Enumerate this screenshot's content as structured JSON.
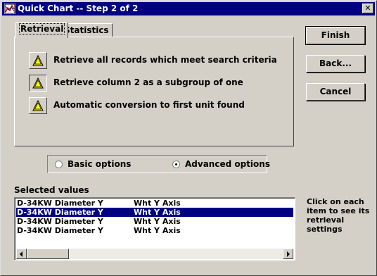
{
  "window": {
    "title": "Quick Chart -- Step 2 of 2",
    "close_label": "✕"
  },
  "tabs": [
    {
      "label": "Retrieval",
      "active": true
    },
    {
      "label": "Statistics",
      "active": false
    }
  ],
  "retrieval_options": [
    {
      "label": "Retrieve all records which meet search criteria",
      "icon": "warning-icon"
    },
    {
      "label": "Retrieve column 2 as a subgroup of one",
      "icon": "warning-icon"
    },
    {
      "label": "Automatic conversion to first unit found",
      "icon": "warning-icon"
    }
  ],
  "buttons": {
    "finish": "Finish",
    "back": "Back...",
    "cancel": "Cancel"
  },
  "options_mode": {
    "basic_label": "Basic options",
    "advanced_label": "Advanced options",
    "selected": "advanced"
  },
  "selected_values": {
    "label": "Selected values",
    "rows": [
      {
        "name": "D-34KW Diameter Y",
        "axis": "Wht Y Axis",
        "selected": false
      },
      {
        "name": "D-34KW Diameter Y",
        "axis": "Wht Y Axis",
        "selected": true
      },
      {
        "name": "D-34KW Diameter Y",
        "axis": "Wht Y Axis",
        "selected": false
      },
      {
        "name": "D-34KW Diameter Y",
        "axis": "Wht Y Axis",
        "selected": false
      }
    ]
  },
  "help_text": "Click on each item to see its retrieval settings",
  "colors": {
    "title_bar": "#000080",
    "selection": "#000080",
    "warning_fill": "#ffff00"
  }
}
